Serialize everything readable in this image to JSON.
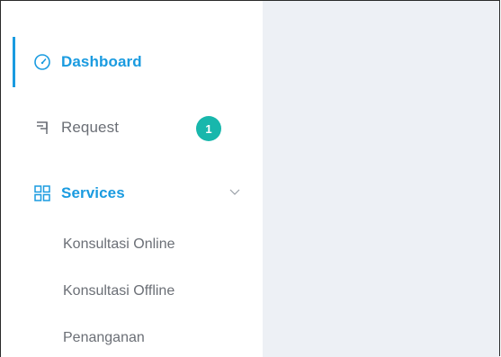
{
  "sidebar": {
    "items": [
      {
        "label": "Dashboard",
        "icon": "speedometer-icon",
        "active": true
      },
      {
        "label": "Request",
        "icon": "flag-icon",
        "badge": "1"
      },
      {
        "label": "Services",
        "icon": "grid-icon",
        "expanded": true,
        "subitems": [
          "Konsultasi Online",
          "Konsultasi Offline",
          "Penanganan"
        ]
      }
    ]
  },
  "colors": {
    "accent": "#1a9be0",
    "badge": "#18b7ac",
    "muted_text": "#6b6f76",
    "content_bg": "#edf0f5"
  }
}
